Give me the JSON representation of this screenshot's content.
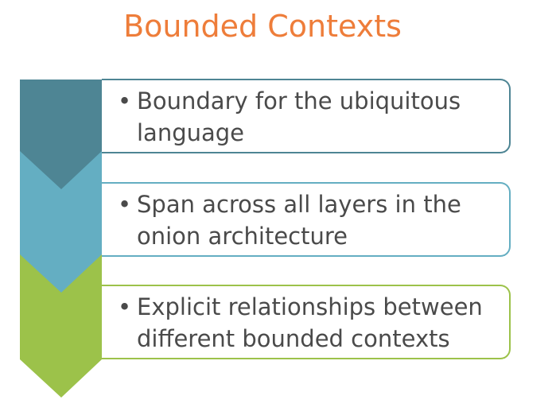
{
  "title": "Bounded Contexts",
  "items": [
    {
      "bullet": "•",
      "text": "Boundary for the ubiquitous language",
      "color": "#4e8594"
    },
    {
      "bullet": "•",
      "text": "Span across all layers in the onion architecture",
      "color": "#64aec2"
    },
    {
      "bullet": "•",
      "text": "Explicit relationships between different bounded contexts",
      "color": "#9cc24a"
    }
  ]
}
